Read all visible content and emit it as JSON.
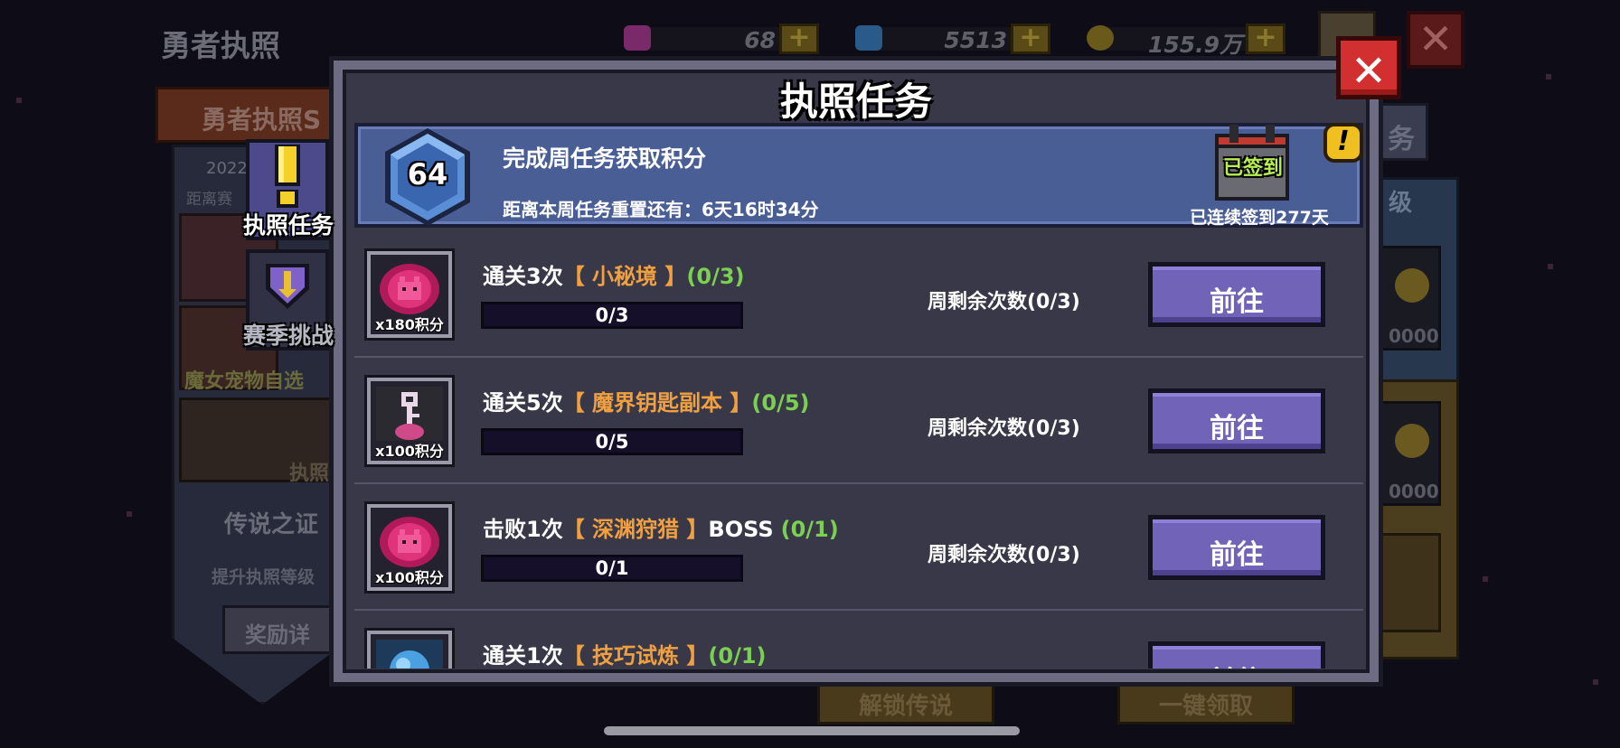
{
  "background": {
    "screen_title": "勇者执照",
    "banner_text": "勇者执照S",
    "year_text": "2022",
    "distance_text": "距离赛",
    "witch_text": "魔女宠物自选",
    "license_text": "执照",
    "legend_text": "传说之证",
    "raise_text": "提升执照等级",
    "reward_button": "奖励详",
    "right_tab": "务",
    "right_level": "级",
    "right_num_1": "0000",
    "right_num_2": "0000",
    "unlock_button": "解锁传说",
    "claim_button": "一键领取",
    "resources": [
      {
        "name": "purple-gem",
        "value": "68",
        "color": "#7a2a6a"
      },
      {
        "name": "blue-gem",
        "value": "5513",
        "color": "#2a5a8a"
      },
      {
        "name": "gold-coin",
        "value": "155.9万",
        "color": "#6a5a1a"
      }
    ],
    "plus_symbol": "+",
    "close_symbol": "✕"
  },
  "side_tabs": [
    {
      "label": "执照任务",
      "icon": "exclamation-icon",
      "active": true
    },
    {
      "label": "赛季挑战",
      "icon": "shield-icon",
      "active": false
    }
  ],
  "modal": {
    "title": "执照任务",
    "close_symbol": "✕",
    "info": {
      "level": "64",
      "title": "完成周任务获取积分",
      "reset_text": "距离本周任务重置还有：6天16时34分",
      "signed_label": "已签到",
      "streak_text": "已连续签到277天",
      "alert_symbol": "!"
    },
    "tasks": [
      {
        "prefix": "通关3次",
        "target": "【 小秘境 】",
        "suffix": "",
        "progress_label": "(0/3)",
        "bar_text": "0/3",
        "progress_fraction": 0.0,
        "reward": "x180积分",
        "icon": "demon-gem-icon",
        "weekly": "周剩余次数(0/3)",
        "button": "前往"
      },
      {
        "prefix": "通关5次",
        "target": "【 魔界钥匙副本 】",
        "suffix": "",
        "progress_label": "(0/5)",
        "bar_text": "0/5",
        "progress_fraction": 0.0,
        "reward": "x100积分",
        "icon": "key-icon",
        "weekly": "周剩余次数(0/3)",
        "button": "前往"
      },
      {
        "prefix": "击败1次",
        "target": "【 深渊狩猎 】",
        "suffix": "BOSS",
        "progress_label": "(0/1)",
        "bar_text": "0/1",
        "progress_fraction": 0.0,
        "reward": "x100积分",
        "icon": "demon-gem-icon",
        "weekly": "周剩余次数(0/3)",
        "button": "前往"
      },
      {
        "prefix": "通关1次",
        "target": "【 技巧试炼 】",
        "suffix": "",
        "progress_label": "(0/1)",
        "bar_text": "",
        "progress_fraction": 0.0,
        "reward": "",
        "icon": "crystal-icon",
        "weekly": "",
        "button": "前往"
      }
    ]
  },
  "colors": {
    "accent_button": "#7163b8",
    "target_text": "#f0a040",
    "progress_text": "#7ad050",
    "signed_text": "#b6f04e",
    "close_red": "#d23030"
  }
}
